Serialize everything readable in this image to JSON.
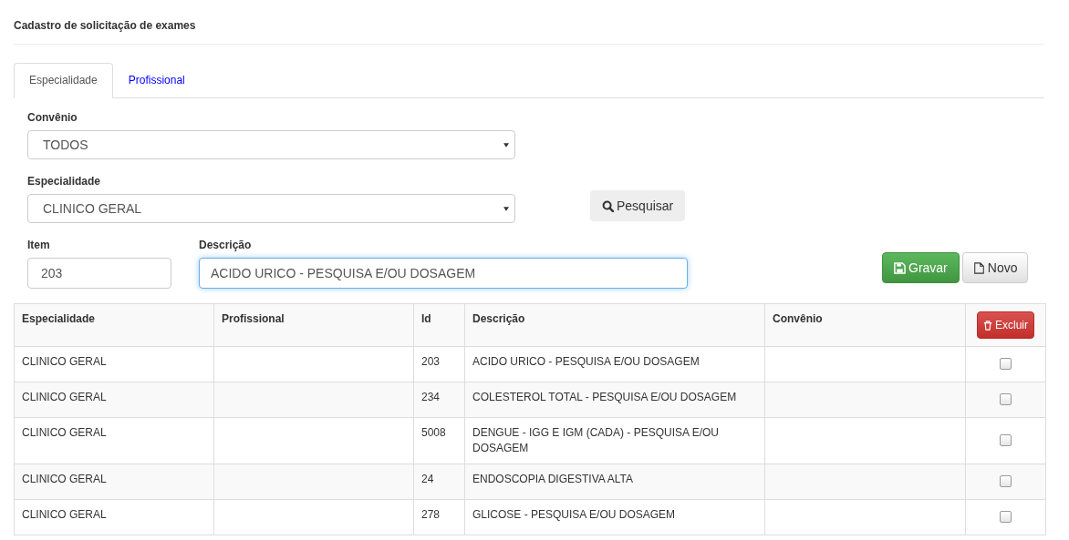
{
  "page_title": "Cadastro de solicitação de exames",
  "tabs": [
    {
      "label": "Especialidade",
      "selected": true
    },
    {
      "label": "Profissional",
      "selected": false
    }
  ],
  "convenio": {
    "label": "Convênio",
    "value": "TODOS"
  },
  "especialidade": {
    "label": "Especialidade",
    "value": "CLINICO GERAL"
  },
  "search_button": "Pesquisar",
  "item": {
    "label": "Item",
    "value": "203"
  },
  "descricao": {
    "label": "Descrição",
    "value": "ACIDO URICO - PESQUISA E/OU DOSAGEM",
    "focused": true
  },
  "save_button": "Gravar",
  "new_button": "Novo",
  "table": {
    "columns": [
      "Especialidade",
      "Profissional",
      "Id",
      "Descrição",
      "Convênio"
    ],
    "delete_button": "Excluir",
    "rows": [
      {
        "especialidade": "CLINICO GERAL",
        "id": "203",
        "descricao": "ACIDO URICO - PESQUISA E/OU DOSAGEM",
        "checked": false
      },
      {
        "especialidade": "CLINICO GERAL",
        "id": "234",
        "descricao": "COLESTEROL TOTAL - PESQUISA E/OU DOSAGEM",
        "checked": false
      },
      {
        "especialidade": "CLINICO GERAL",
        "id": "5008",
        "descricao": "DENGUE - IGG E IGM (CADA) - PESQUISA E/OU DOSAGEM",
        "checked": false
      },
      {
        "especialidade": "CLINICO GERAL",
        "id": "24",
        "descricao": "ENDOSCOPIA DIGESTIVA ALTA",
        "checked": false
      },
      {
        "especialidade": "CLINICO GERAL",
        "id": "278",
        "descricao": "GLICOSE - PESQUISA E/OU DOSAGEM",
        "checked": false
      }
    ]
  }
}
